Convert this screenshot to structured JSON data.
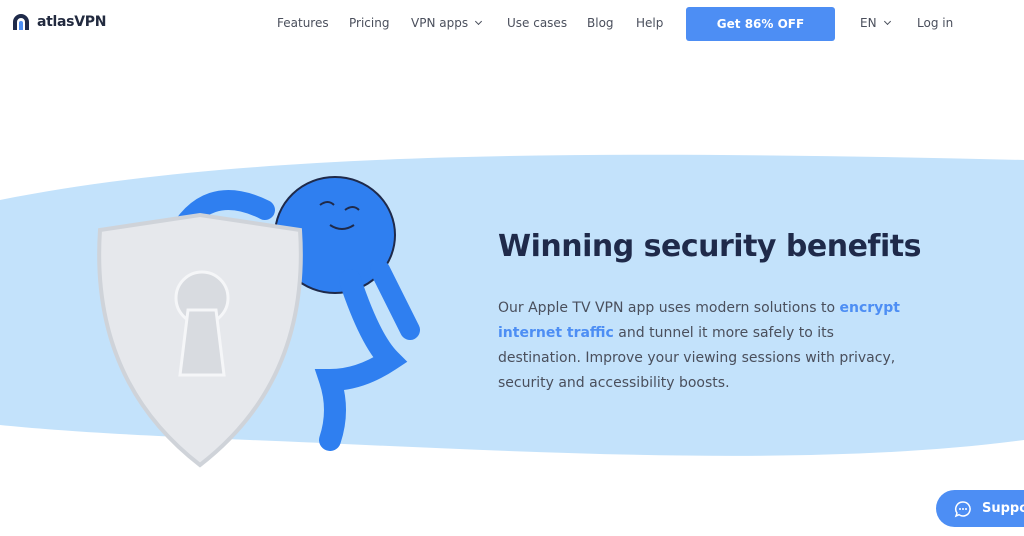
{
  "nav": {
    "brand": "atlasVPN",
    "links": [
      "Features",
      "Pricing",
      "VPN apps",
      "Use cases",
      "Blog",
      "Help"
    ],
    "cta": "Get 86% OFF",
    "language": "EN",
    "login": "Log in"
  },
  "hero": {
    "title": "Winning security benefits",
    "text_before": "Our Apple TV VPN app uses modern solutions to ",
    "highlight": "encrypt internet traffic",
    "text_after": " and tunnel it more safely to its destination. Improve your viewing sessions with privacy, security and accessibility boosts."
  },
  "support": {
    "label": "Support"
  },
  "colors": {
    "accent": "#4d8ef4",
    "band": "#c3e2fb",
    "heading": "#1f2a4a"
  }
}
